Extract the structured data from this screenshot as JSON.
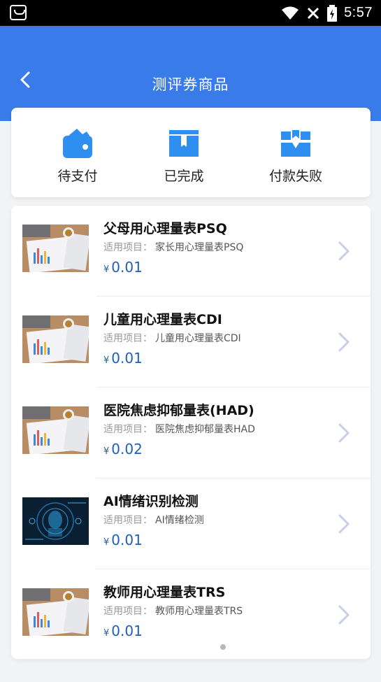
{
  "status_bar": {
    "time": "5:57"
  },
  "header": {
    "title": "测评券商品"
  },
  "tabs": [
    {
      "label": "待支付",
      "icon": "wallet-icon"
    },
    {
      "label": "已完成",
      "icon": "box-icon"
    },
    {
      "label": "付款失败",
      "icon": "broken-box-icon"
    }
  ],
  "list": {
    "sub_prefix": "适用项目：",
    "currency": "¥",
    "items": [
      {
        "title": "父母用心理量表PSQ",
        "project": "家长用心理量表PSQ",
        "price": "0.01",
        "thumb": "desk-chart-image"
      },
      {
        "title": "儿童用心理量表CDI",
        "project": "儿童用心理量表CDI",
        "price": "0.01",
        "thumb": "desk-chart-image"
      },
      {
        "title": "医院焦虑抑郁量表(HAD)",
        "project": "医院焦虑抑郁量表HAD",
        "price": "0.02",
        "thumb": "desk-chart-image"
      },
      {
        "title": "AI情绪识别检测",
        "project": "AI情绪检测",
        "price": "0.01",
        "thumb": "ai-face-image"
      },
      {
        "title": "教师用心理量表TRS",
        "project": "教师用心理量表TRS",
        "price": "0.01",
        "thumb": "desk-chart-image"
      }
    ]
  },
  "colors": {
    "primary": "#3a7bea",
    "price": "#1f5fb8",
    "icon_blue": "#2e8ff0"
  }
}
